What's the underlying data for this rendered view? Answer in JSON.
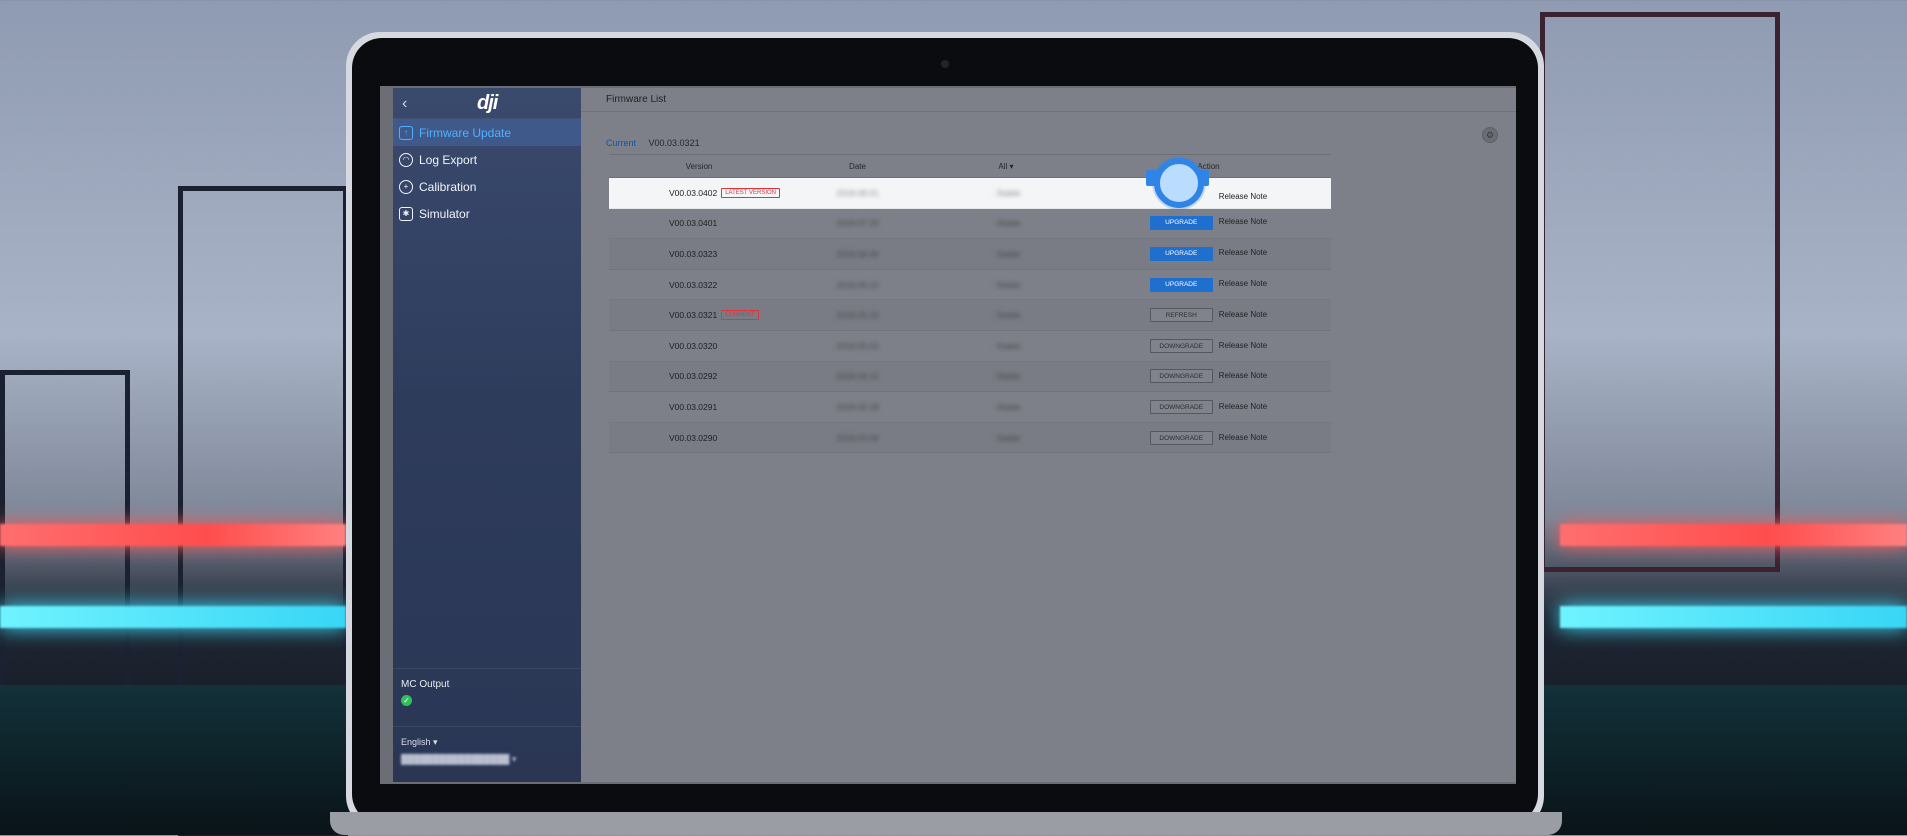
{
  "sidebar": {
    "logo": "dji",
    "items": [
      {
        "label": "Firmware Update",
        "icon": "update-icon",
        "active": true
      },
      {
        "label": "Log Export",
        "icon": "gauge-icon",
        "active": false
      },
      {
        "label": "Calibration",
        "icon": "target-icon",
        "active": false
      },
      {
        "label": "Simulator",
        "icon": "simulator-icon",
        "active": false
      }
    ],
    "mc_output_label": "MC Output",
    "language": "English"
  },
  "main": {
    "title": "Firmware List",
    "current_label": "Current",
    "current_version": "V00.03.0321",
    "columns": {
      "version": "Version",
      "date": "Date",
      "filter": "All",
      "action": "Action"
    },
    "rows": [
      {
        "version": "V00.03.0402",
        "tag": "LATEST VERSION",
        "action": "",
        "note": "Release Note"
      },
      {
        "version": "V00.03.0401",
        "tag": "",
        "action": "UPGRADE",
        "note": "Release Note"
      },
      {
        "version": "V00.03.0323",
        "tag": "",
        "action": "UPGRADE",
        "note": "Release Note"
      },
      {
        "version": "V00.03.0322",
        "tag": "",
        "action": "UPGRADE",
        "note": "Release Note"
      },
      {
        "version": "V00.03.0321",
        "tag": "CURRENT",
        "action": "REFRESH",
        "note": "Release Note"
      },
      {
        "version": "V00.03.0320",
        "tag": "",
        "action": "DOWNGRADE",
        "note": "Release Note"
      },
      {
        "version": "V00.03.0292",
        "tag": "",
        "action": "DOWNGRADE",
        "note": "Release Note"
      },
      {
        "version": "V00.03.0291",
        "tag": "",
        "action": "DOWNGRADE",
        "note": "Release Note"
      },
      {
        "version": "V00.03.0290",
        "tag": "",
        "action": "DOWNGRADE",
        "note": "Release Note"
      }
    ]
  },
  "colors": {
    "accent": "#1f6fcf",
    "active_nav": "#4fb0ff",
    "tag_red": "#d9363e",
    "ok_green": "#2fc25b"
  }
}
